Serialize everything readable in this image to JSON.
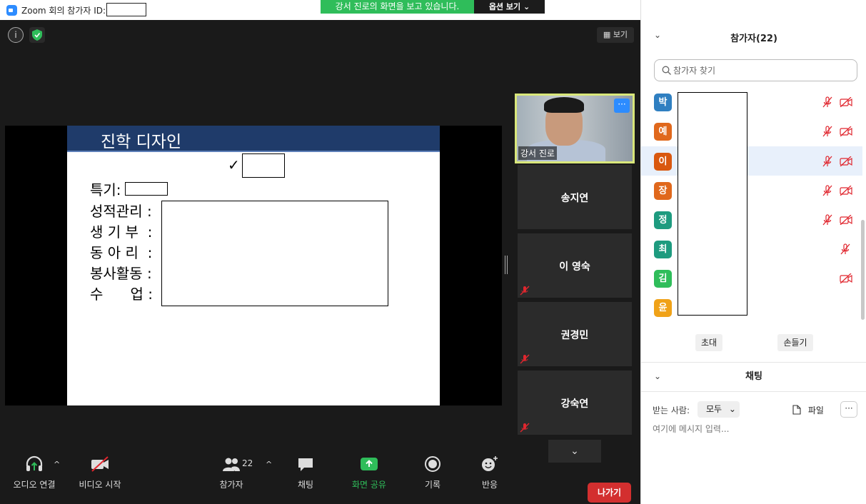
{
  "window": {
    "title": "Zoom 회의 참가자 ID:",
    "share_banner": "강서 진로의 화면을 보고 있습니다.",
    "options_label": "옵션 보기",
    "min_glyph": "—",
    "max_glyph": "☐",
    "close_glyph": "✕"
  },
  "meeting": {
    "info_glyph": "i",
    "view_label": "보기",
    "slide": {
      "title": "진학 디자인",
      "check": "✓",
      "special_label": "특기:",
      "lines": [
        "성적관리 :",
        "생 기 부  :",
        "동 아 리  :",
        "봉사활동 :",
        "수      업 :"
      ]
    },
    "tiles": [
      {
        "name": "강서 진로",
        "active": true
      },
      {
        "name": "송지연"
      },
      {
        "name": "이 영숙"
      },
      {
        "name": "권경민"
      },
      {
        "name": "강숙연"
      }
    ],
    "video_more": "···",
    "tiles_down_glyph": "⌄"
  },
  "toolbar": {
    "audio": "오디오 연결",
    "video": "비디오 시작",
    "participants": "참가자",
    "participants_count": "22",
    "chat": "채팅",
    "share": "화면 공유",
    "record": "기록",
    "reactions": "반응",
    "leave": "나가기",
    "caret": "^"
  },
  "panel": {
    "header": "참가자(22)",
    "collapse_glyph": "⌄",
    "search_placeholder": "참가자 찾기",
    "participants": [
      {
        "initial": "박",
        "color": "#2f7fc1",
        "mic_off": true,
        "cam_off": true
      },
      {
        "initial": "예",
        "color": "#e0681c",
        "mic_off": true,
        "cam_off": true
      },
      {
        "initial": "이",
        "color": "#d9580f",
        "mic_off": true,
        "cam_off": true,
        "selected": true
      },
      {
        "initial": "장",
        "color": "#e0681c",
        "mic_off": true,
        "cam_off": true
      },
      {
        "initial": "정",
        "color": "#1e9b7f",
        "mic_off": true,
        "cam_off": true
      },
      {
        "initial": "최",
        "color": "#1e9b7f",
        "mic_off": true,
        "cam_off": false
      },
      {
        "initial": "김",
        "color": "#2fbd5a",
        "mic_off": false,
        "cam_off": true
      },
      {
        "initial": "윤",
        "color": "#f0a218",
        "mic_off": false,
        "cam_off": false
      }
    ],
    "invite": "초대",
    "raise_hand": "손들기",
    "chat_header": "채팅",
    "to_label": "받는 사람:",
    "to_value": "모두",
    "to_caret": "⌄",
    "file_label": "파일",
    "more_label": "···",
    "chat_placeholder": "여기에 메시지 입력..."
  },
  "colors": {
    "accent": "#2d8cff",
    "share_green": "#2fbd5a",
    "leave_red": "#d32f2f",
    "mute_red": "#e0262e"
  }
}
